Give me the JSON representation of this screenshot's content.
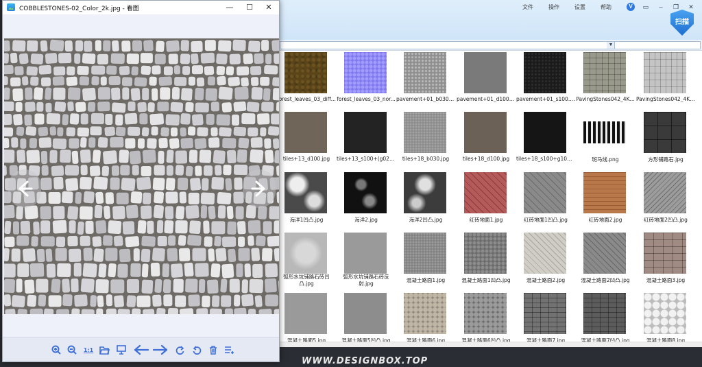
{
  "viewer": {
    "title": "COBBLESTONES-02_Color_2k.jpg - 看图",
    "window_controls": {
      "minimize": "—",
      "maximize": "☐",
      "close": "✕"
    },
    "toolbar": {
      "actual_size_label": "1:1",
      "icons": [
        "zoom-in-icon",
        "zoom-out-icon",
        "actual-size-icon",
        "open-folder-icon",
        "slideshow-icon",
        "previous-arrow-icon",
        "next-arrow-icon",
        "rotate-right-icon",
        "rotate-left-icon",
        "delete-icon",
        "more-icon"
      ]
    },
    "accent_color": "#3f6fd8"
  },
  "file_manager": {
    "menu": [
      "文件",
      "操作",
      "设置",
      "帮助"
    ],
    "badge_label": "扫描",
    "files": [
      [
        "forest_leaves_03_diff...",
        "forest_leaves_03_nor...",
        "pavement+01_b030....",
        "pavement+01_d100....",
        "pavement+01_s100.jpg",
        "PavingStones042_4K...",
        "PavingStones042_4K_..."
      ],
      [
        "tiles+13_d100.jpg",
        "tiles+13_s100+(g025...",
        "tiles+18_b030.jpg",
        "tiles+18_d100.jpg",
        "tiles+18_s100+g100....",
        "斑马线.png",
        "方形铺路石.jpg"
      ],
      [
        "海洋1凹凸.jpg",
        "海洋2.jpg",
        "海洋2凹凸.jpg",
        "红砖地面1.jpg",
        "红砖地面1凹凸.jpg",
        "红砖地面2.jpg",
        "红砖地面2凹凸.jpg"
      ],
      [
        "弧形水坑铺路石砖凹凸.jpg",
        "弧形水坑铺路石砖反射.jpg",
        "混凝土路面1.jpg",
        "混凝土路面1凹凸.jpg",
        "混凝土路面2.jpg",
        "混凝土路面2凹凸.jpg",
        "混凝土路面3.jpg"
      ],
      [
        "混凝土路面5.jpg",
        "混凝土路面5凹凸.jpg",
        "混凝土路面6.jpg",
        "混凝土路面6凹凸.jpg",
        "混凝土路面7.jpg",
        "混凝土路面7凹凸.jpg",
        "混凝土路面8.jpg"
      ]
    ]
  },
  "watermark": "WWW.DESIGNBOX.TOP"
}
